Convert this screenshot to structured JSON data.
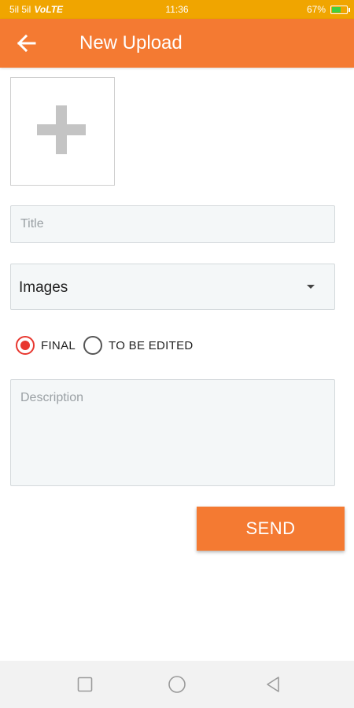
{
  "status_bar": {
    "signal": "5il 5il",
    "network": "VoLTE",
    "time": "11:36",
    "battery": "67%",
    "battery_level": 0.67
  },
  "app_bar": {
    "title": "New Upload",
    "back_icon": "arrow-left-icon"
  },
  "image_picker": {
    "icon": "plus-icon"
  },
  "form": {
    "title_placeholder": "Title",
    "title_value": "",
    "type_selected": "Images",
    "status_options": [
      {
        "label": "FINAL",
        "checked": true
      },
      {
        "label": "TO BE EDITED",
        "checked": false
      }
    ],
    "description_placeholder": "Description",
    "description_value": "",
    "send_label": "SEND"
  },
  "nav_bar": {
    "recents_icon": "square-icon",
    "home_icon": "circle-icon",
    "back_icon": "triangle-back-icon"
  },
  "colors": {
    "status_bar": "#f0a500",
    "primary": "#f47a32",
    "radio_checked": "#e8372f",
    "field_bg": "#f4f7f8"
  }
}
